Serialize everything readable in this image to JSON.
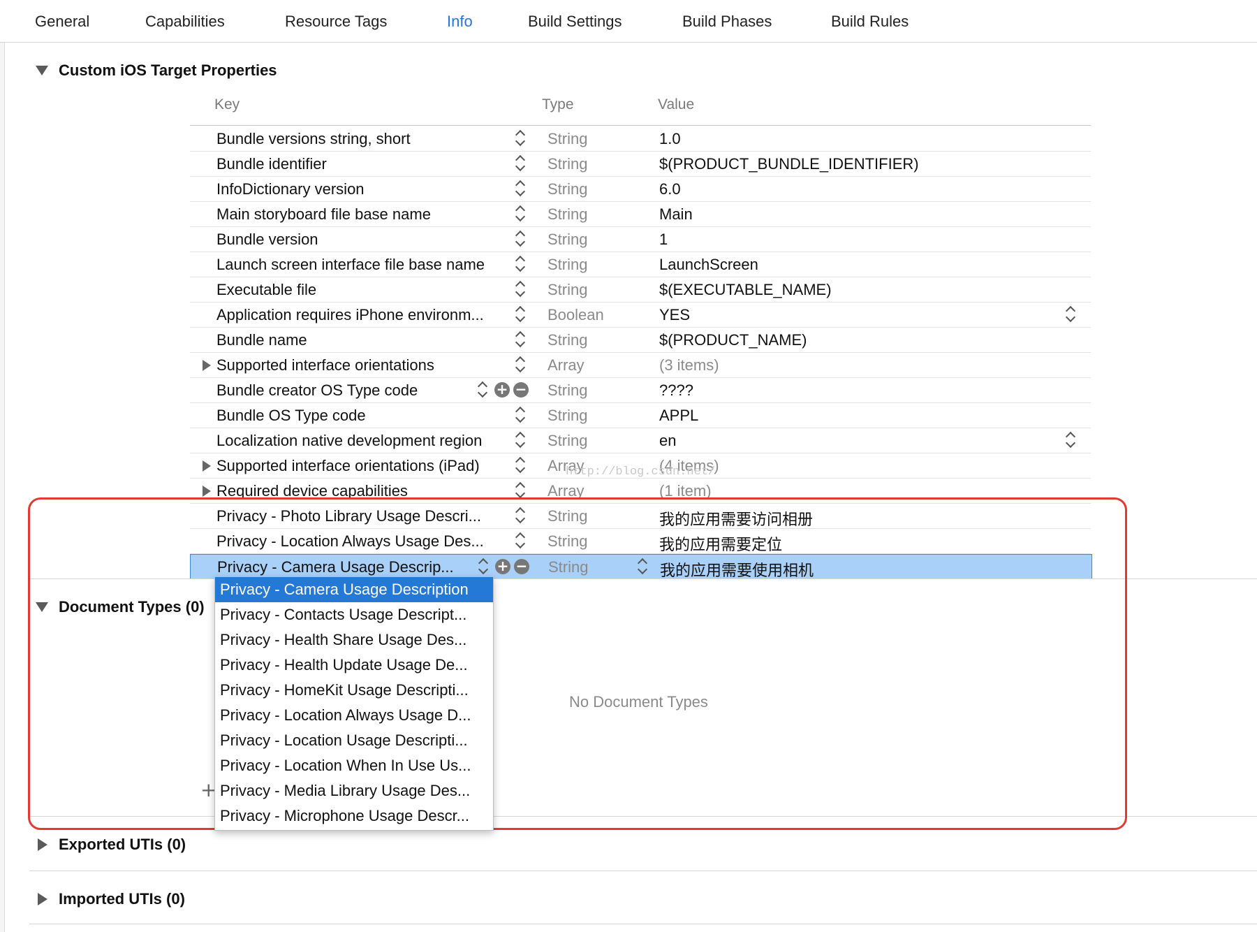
{
  "tabs": [
    "General",
    "Capabilities",
    "Resource Tags",
    "Info",
    "Build Settings",
    "Build Phases",
    "Build Rules"
  ],
  "active_tab": "Info",
  "custom_properties": {
    "title": "Custom iOS Target Properties",
    "columns": {
      "key": "Key",
      "type": "Type",
      "value": "Value"
    },
    "rows": [
      {
        "key": "Bundle versions string, short",
        "type": "String",
        "value": "1.0"
      },
      {
        "key": "Bundle identifier",
        "type": "String",
        "value": "$(PRODUCT_BUNDLE_IDENTIFIER)"
      },
      {
        "key": "InfoDictionary version",
        "type": "String",
        "value": "6.0"
      },
      {
        "key": "Main storyboard file base name",
        "type": "String",
        "value": "Main"
      },
      {
        "key": "Bundle version",
        "type": "String",
        "value": "1"
      },
      {
        "key": "Launch screen interface file base name",
        "type": "String",
        "value": "LaunchScreen"
      },
      {
        "key": "Executable file",
        "type": "String",
        "value": "$(EXECUTABLE_NAME)"
      },
      {
        "key": "Application requires iPhone environm...",
        "type": "Boolean",
        "value": "YES"
      },
      {
        "key": "Bundle name",
        "type": "String",
        "value": "$(PRODUCT_NAME)"
      },
      {
        "key": "Supported interface orientations",
        "type": "Array",
        "value": "(3 items)"
      },
      {
        "key": "Bundle creator OS Type code",
        "type": "String",
        "value": "????"
      },
      {
        "key": "Bundle OS Type code",
        "type": "String",
        "value": "APPL"
      },
      {
        "key": "Localization native development region",
        "type": "String",
        "value": "en"
      },
      {
        "key": "Supported interface orientations (iPad)",
        "type": "Array",
        "value": "(4 items)"
      },
      {
        "key": "Required device capabilities",
        "type": "Array",
        "value": "(1 item)"
      },
      {
        "key": "Privacy - Photo Library Usage Descri...",
        "type": "String",
        "value": "我的应用需要访问相册"
      },
      {
        "key": "Privacy - Location Always Usage Des...",
        "type": "String",
        "value": "我的应用需要定位"
      },
      {
        "key": "Privacy - Camera Usage Descrip...",
        "type": "String",
        "value": "我的应用需要使用相机"
      }
    ]
  },
  "document_types": {
    "title": "Document Types (0)",
    "empty_message": "No Document Types"
  },
  "dropdown_items": [
    "Privacy - Camera Usage Description",
    "Privacy - Contacts Usage Descript...",
    "Privacy - Health Share Usage Des...",
    "Privacy - Health Update Usage De...",
    "Privacy - HomeKit Usage Descripti...",
    "Privacy - Location Always Usage D...",
    "Privacy - Location Usage Descripti...",
    "Privacy - Location When In Use Us...",
    "Privacy - Media Library Usage Des...",
    "Privacy - Microphone Usage Descr..."
  ],
  "exported_utis": {
    "title": "Exported UTIs (0)"
  },
  "imported_utis": {
    "title": "Imported UTIs (0)"
  },
  "watermark": "http://blog.csdn.net/",
  "colors": {
    "accent": "#2476d8",
    "selection": "#a8d0f8",
    "highlight_frame": "#e23a33"
  }
}
